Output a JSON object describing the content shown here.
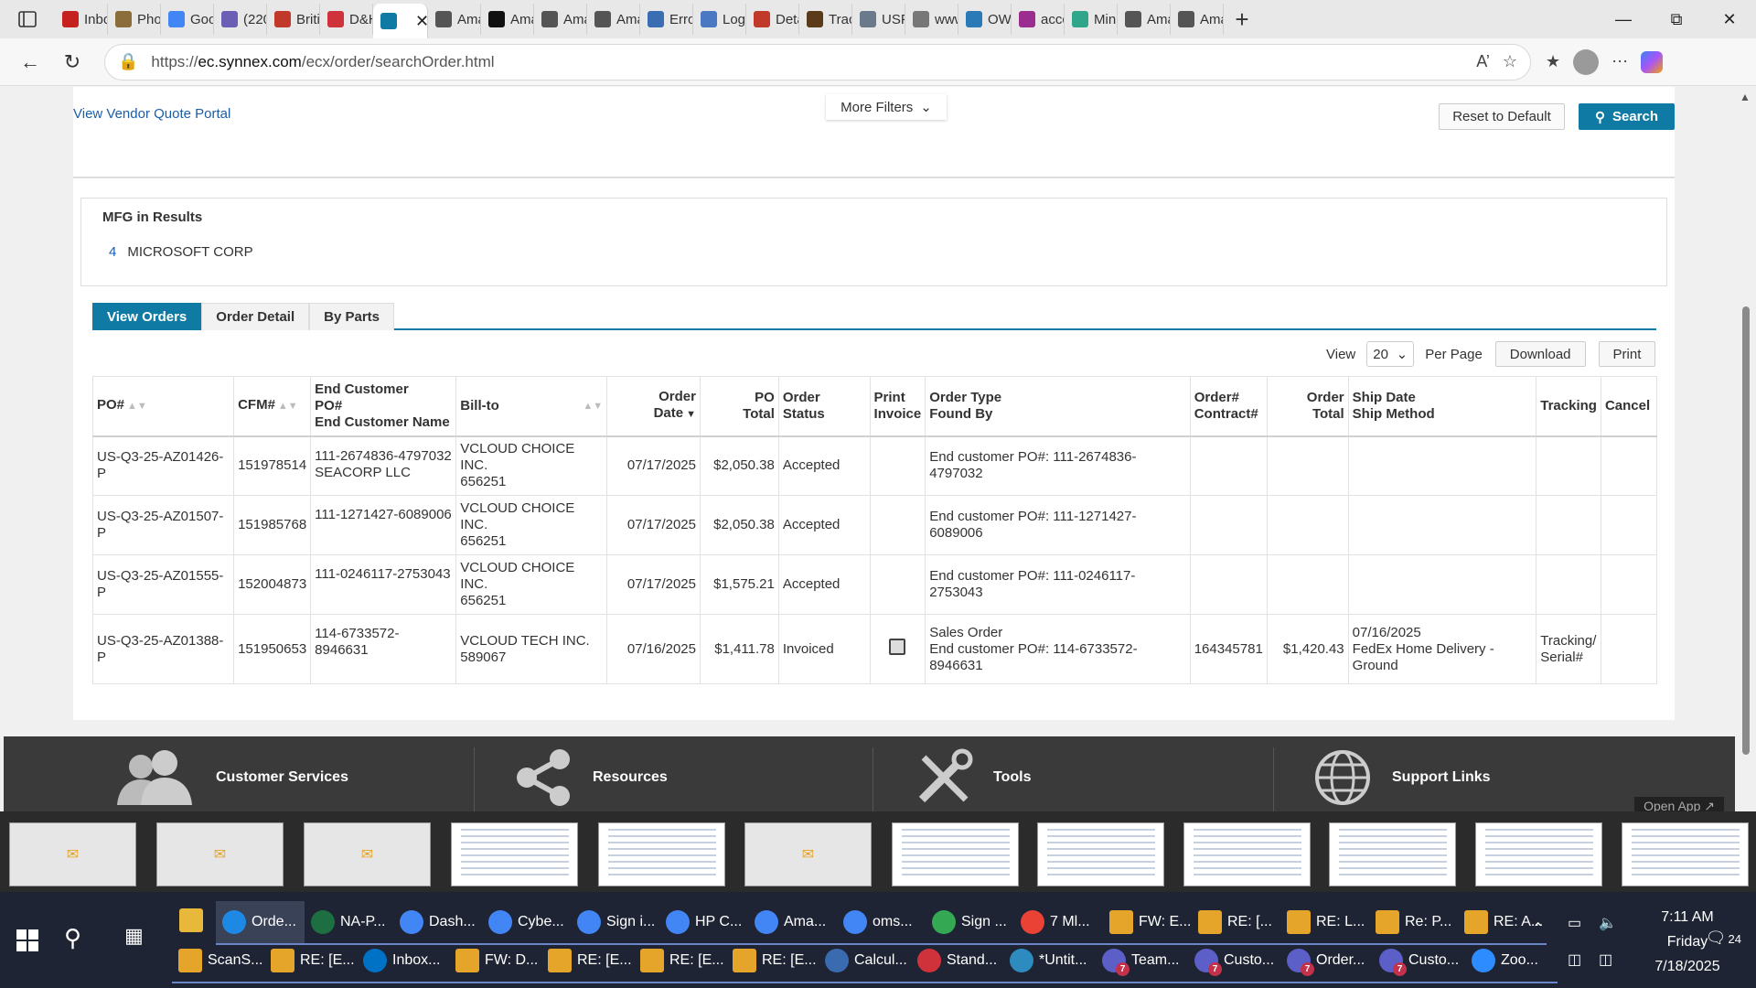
{
  "browser": {
    "tabs": [
      {
        "label": "Inbo",
        "color": "#c5221f",
        "active": false
      },
      {
        "label": "Phot",
        "color": "#8a6d3b",
        "active": false
      },
      {
        "label": "Goo",
        "color": "#4285f4",
        "active": false
      },
      {
        "label": "(220",
        "color": "#6b5fb5",
        "active": false
      },
      {
        "label": "Britis",
        "color": "#c0392b",
        "active": false
      },
      {
        "label": "D&H",
        "color": "#d0323c",
        "active": false
      },
      {
        "label": "",
        "color": "#0f7aa3",
        "active": true
      },
      {
        "label": "Ama",
        "color": "#555555",
        "active": false
      },
      {
        "label": "Ama",
        "color": "#111111",
        "active": false
      },
      {
        "label": "Ama",
        "color": "#555555",
        "active": false
      },
      {
        "label": "Ama",
        "color": "#555555",
        "active": false
      },
      {
        "label": "Erro",
        "color": "#3b6db3",
        "active": false
      },
      {
        "label": "Log",
        "color": "#4a78c2",
        "active": false
      },
      {
        "label": "Deta",
        "color": "#c0392b",
        "active": false
      },
      {
        "label": "Trac",
        "color": "#5b3a1a",
        "active": false
      },
      {
        "label": "USP",
        "color": "#6a7a8a",
        "active": false
      },
      {
        "label": "www",
        "color": "#777777",
        "active": false
      },
      {
        "label": "OW",
        "color": "#2a7ab8",
        "active": false
      },
      {
        "label": "accc",
        "color": "#9b2d8f",
        "active": false
      },
      {
        "label": "Mini",
        "color": "#2fa58a",
        "active": false
      },
      {
        "label": "Ama",
        "color": "#555555",
        "active": false
      },
      {
        "label": "Ama",
        "color": "#555555",
        "active": false
      }
    ],
    "url_prefix": "https://",
    "url_host": "ec.synnex.com",
    "url_path": "/ecx/order/searchOrder.html"
  },
  "top": {
    "vendor_quote_link": "View Vendor Quote Portal",
    "more_filters": "More Filters",
    "reset_button": "Reset to Default",
    "search_button": "Search"
  },
  "mfg": {
    "title": "MFG in Results",
    "items": [
      {
        "count": "4",
        "name": "MICROSOFT CORP"
      }
    ]
  },
  "tabs": [
    "View Orders",
    "Order Detail",
    "By Parts"
  ],
  "controls": {
    "view_label": "View",
    "per_page_value": "20",
    "per_page_label": "Per Page",
    "download": "Download",
    "print": "Print"
  },
  "table": {
    "headers": {
      "po": "PO#",
      "cfm": "CFM#",
      "end_customer_1": "End Customer",
      "end_customer_2": "PO#",
      "end_customer_3": "End Customer Name",
      "bill_to": "Bill-to",
      "order_date_1": "Order",
      "order_date_2": "Date",
      "po_total_1": "PO",
      "po_total_2": "Total",
      "order_status_1": "Order",
      "order_status_2": "Status",
      "print_invoice_1": "Print",
      "print_invoice_2": "Invoice",
      "order_type_1": "Order Type",
      "order_type_2": "Found By",
      "order_contract_1": "Order#",
      "order_contract_2": "Contract#",
      "order_total_1": "Order",
      "order_total_2": "Total",
      "ship_1": "Ship Date",
      "ship_2": "Ship Method",
      "tracking": "Tracking",
      "cancel": "Cancel"
    },
    "rows": [
      {
        "po_1": "US-Q3-25-AZ01426-",
        "po_2": "P",
        "cfm": "151978514",
        "end_po": "111-2674836-4797032",
        "end_name": "SEACORP LLC",
        "bill_1": "VCLOUD CHOICE",
        "bill_2": "INC.",
        "bill_3": "656251",
        "order_date": "07/17/2025",
        "po_total": "$2,050.38",
        "status": "Accepted",
        "type_1": "",
        "type_2": "End customer PO#: 111-2674836-",
        "type_3": "4797032",
        "order_no": "",
        "order_total": "",
        "ship_date": "",
        "ship_method": "",
        "tracking": ""
      },
      {
        "po_1": "US-Q3-25-AZ01507-",
        "po_2": "P",
        "cfm": "151985768",
        "end_po": "111-1271427-6089006",
        "end_name": "",
        "bill_1": "VCLOUD CHOICE",
        "bill_2": "INC.",
        "bill_3": "656251",
        "order_date": "07/17/2025",
        "po_total": "$2,050.38",
        "status": "Accepted",
        "type_1": "",
        "type_2": "End customer PO#: 111-1271427-",
        "type_3": "6089006",
        "order_no": "",
        "order_total": "",
        "ship_date": "",
        "ship_method": "",
        "tracking": ""
      },
      {
        "po_1": "US-Q3-25-AZ01555-",
        "po_2": "P",
        "cfm": "152004873",
        "end_po": "111-0246117-2753043",
        "end_name": "",
        "bill_1": "VCLOUD CHOICE",
        "bill_2": "INC.",
        "bill_3": "656251",
        "order_date": "07/17/2025",
        "po_total": "$1,575.21",
        "status": "Accepted",
        "type_1": "",
        "type_2": "End customer PO#: 111-0246117-",
        "type_3": "2753043",
        "order_no": "",
        "order_total": "",
        "ship_date": "",
        "ship_method": "",
        "tracking": ""
      },
      {
        "po_1": "US-Q3-25-AZ01388-",
        "po_2": "P",
        "cfm": "151950653",
        "end_po": "114-6733572-8946631",
        "end_name": "",
        "bill_1": "VCLOUD TECH INC.",
        "bill_2": "589067",
        "bill_3": "",
        "order_date": "07/16/2025",
        "po_total": "$1,411.78",
        "status": "Invoiced",
        "type_1": "Sales Order",
        "type_2": "End customer PO#: 114-6733572-",
        "type_3": "8946631",
        "order_no": "164345781",
        "order_total": "$1,420.43",
        "ship_date": "07/16/2025",
        "ship_method": "FedEx Home Delivery - Ground",
        "tracking": "Tracking/ Serial#"
      }
    ]
  },
  "footer": {
    "items": [
      "Customer Services",
      "Resources",
      "Tools",
      "Support Links"
    ],
    "open_app": "Open App"
  },
  "taskbar": {
    "row1": [
      {
        "label": "Orde...",
        "color": "#1e88e5"
      },
      {
        "label": "NA-P...",
        "color": "#1d6f42"
      },
      {
        "label": "Dash...",
        "color": "#4285f4"
      },
      {
        "label": "Cybe...",
        "color": "#4285f4"
      },
      {
        "label": "Sign i...",
        "color": "#4285f4"
      },
      {
        "label": "HP C...",
        "color": "#4285f4"
      },
      {
        "label": "Ama...",
        "color": "#4285f4"
      },
      {
        "label": "oms...",
        "color": "#4285f4"
      },
      {
        "label": "Sign ...",
        "color": "#34a853"
      },
      {
        "label": "7 Ml...",
        "color": "#ea4335"
      },
      {
        "label": "FW: E...",
        "color": "#e5a52b"
      },
      {
        "label": "RE: [...",
        "color": "#e5a52b"
      },
      {
        "label": "RE: L...",
        "color": "#e5a52b"
      },
      {
        "label": "Re: P...",
        "color": "#e5a52b"
      },
      {
        "label": "RE: A...",
        "color": "#e5a52b"
      }
    ],
    "row2": [
      {
        "label": "ScanS...",
        "color": "#e5a52b"
      },
      {
        "label": "RE: [E...",
        "color": "#e5a52b"
      },
      {
        "label": "Inbox...",
        "color": "#0072c6"
      },
      {
        "label": "FW: D...",
        "color": "#e5a52b"
      },
      {
        "label": "RE: [E...",
        "color": "#e5a52b"
      },
      {
        "label": "RE: [E...",
        "color": "#e5a52b"
      },
      {
        "label": "RE: [E...",
        "color": "#e5a52b"
      },
      {
        "label": "Calcul...",
        "color": "#3a6ab0"
      },
      {
        "label": "Stand...",
        "color": "#d0323c"
      },
      {
        "label": "*Untit...",
        "color": "#2e8bc0"
      },
      {
        "label": "Team...",
        "color": "#5b5fc7",
        "badge": "7"
      },
      {
        "label": "Custo...",
        "color": "#5b5fc7",
        "badge": "7"
      },
      {
        "label": "Order...",
        "color": "#5b5fc7",
        "badge": "7"
      },
      {
        "label": "Custo...",
        "color": "#5b5fc7",
        "badge": "7"
      },
      {
        "label": "Zoo...",
        "color": "#2d8cff"
      }
    ],
    "time": "7:11 AM",
    "day": "Friday",
    "date": "7/18/2025",
    "notifications": "24"
  }
}
